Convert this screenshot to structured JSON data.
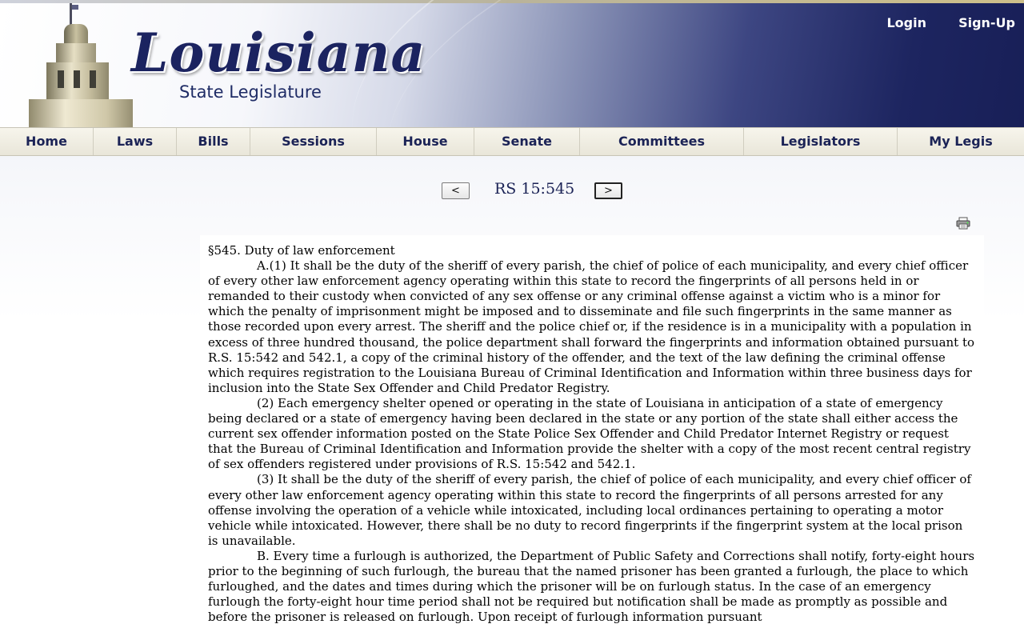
{
  "header": {
    "logo_main": "Louisiana",
    "logo_sub": "State Legislature",
    "login_label": "Login",
    "signup_label": "Sign-Up"
  },
  "nav": {
    "items": [
      {
        "label": "Home"
      },
      {
        "label": "Laws"
      },
      {
        "label": "Bills"
      },
      {
        "label": "Sessions"
      },
      {
        "label": "House"
      },
      {
        "label": "Senate"
      },
      {
        "label": "Committees"
      },
      {
        "label": "Legislators"
      },
      {
        "label": "My Legis"
      }
    ]
  },
  "pager": {
    "prev_label": "<",
    "next_label": ">",
    "title": "RS 15:545"
  },
  "icons": {
    "print": "printer-icon"
  },
  "document": {
    "heading": "§545. Duty of law enforcement",
    "paragraphs": [
      "A.(1) It shall be the duty of the sheriff of every parish, the chief of police of each municipality, and every chief officer of every other law enforcement agency operating within this state to record the fingerprints of all persons held in or remanded to their custody when convicted of any sex offense or any criminal offense against a victim who is a minor for which the penalty of imprisonment might be imposed and to disseminate and file such fingerprints in the same manner as those recorded upon every arrest. The sheriff and the police chief or, if the residence is in a municipality with a population in excess of three hundred thousand, the police department shall forward the fingerprints and information obtained pursuant to R.S. 15:542 and 542.1, a copy of the criminal history of the offender, and the text of the law defining the criminal offense which requires registration to the Louisiana Bureau of Criminal Identification and Information within three business days for inclusion into the State Sex Offender and Child Predator Registry.",
      "(2) Each emergency shelter opened or operating in the state of Louisiana in anticipation of a state of emergency being declared or a state of emergency having been declared in the state or any portion of the state shall either access the current sex offender information posted on the State Police Sex Offender and Child Predator Internet Registry or request that the Bureau of Criminal Identification and Information provide the shelter with a copy of the most recent central registry of sex offenders registered under provisions of R.S. 15:542 and 542.1.",
      "(3) It shall be the duty of the sheriff of every parish, the chief of police of each municipality, and every chief officer of every other law enforcement agency operating within this state to record the fingerprints of all persons arrested for any offense involving the operation of a vehicle while intoxicated, including local ordinances pertaining to operating a motor vehicle while intoxicated. However, there shall be no duty to record fingerprints if the fingerprint system at the local prison is unavailable.",
      "B. Every time a furlough is authorized, the Department of Public Safety and Corrections shall notify, forty-eight hours prior to the beginning of such furlough, the bureau that the named prisoner has been granted a furlough, the place to which furloughed, and the dates and times during which the prisoner will be on furlough status. In the case of an emergency furlough the forty-eight hour time period shall not be required but notification shall be made as promptly as possible and before the prisoner is released on furlough. Upon receipt of furlough information pursuant"
    ]
  }
}
